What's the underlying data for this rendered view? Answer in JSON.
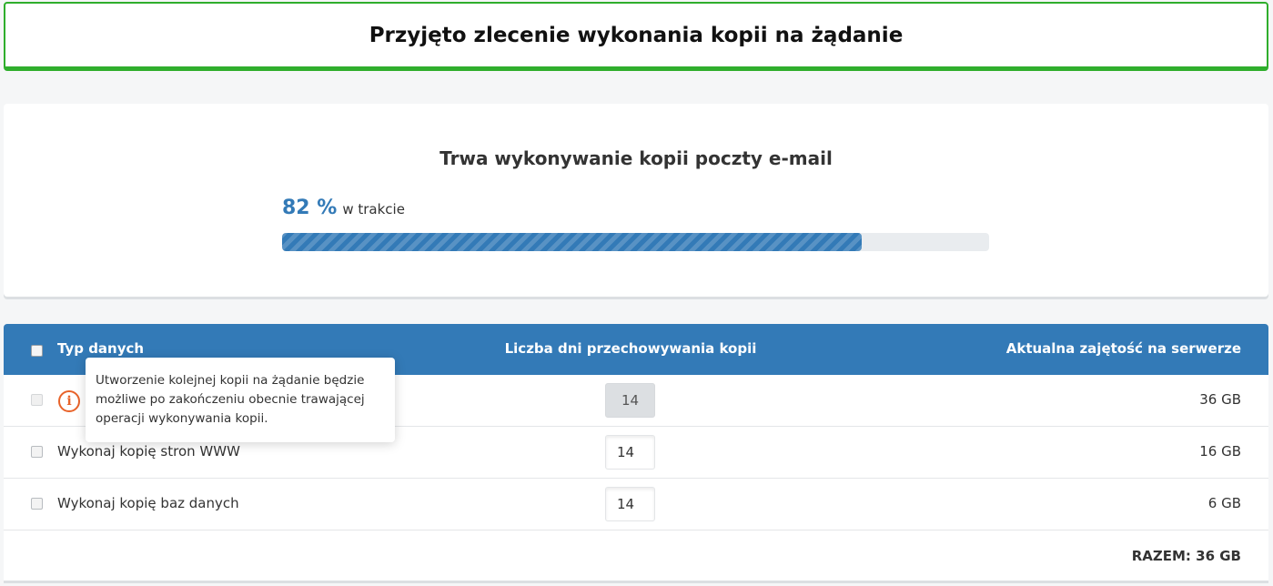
{
  "banner": {
    "title": "Przyjęto zlecenie wykonania kopii na żądanie"
  },
  "progress": {
    "heading": "Trwa wykonywanie kopii poczty e-mail",
    "percent_text": "82 %",
    "status_text": "w trakcie",
    "value": 0.82
  },
  "table": {
    "headers": {
      "type": "Typ danych",
      "days": "Liczba dni przechowywania kopii",
      "usage": "Aktualna zajętość na serwerze"
    },
    "rows": [
      {
        "label": "",
        "days": "14",
        "usage": "36 GB",
        "disabled": true
      },
      {
        "label": "Wykonaj kopię stron WWW",
        "days": "14",
        "usage": "16 GB",
        "disabled": false
      },
      {
        "label": "Wykonaj kopię baz danych",
        "days": "14",
        "usage": "6 GB",
        "disabled": false
      }
    ],
    "total": "RAZEM: 36 GB"
  },
  "tooltip": {
    "text": "Utworzenie kolejnej kopii na żądanie będzie możliwe po zakończeniu obecnie trawającej operacji wykonywania kopii."
  },
  "colors": {
    "accent": "#337ab7",
    "success": "#2fae2c",
    "warning": "#e8632a"
  },
  "icons": {
    "info": "info-circle-icon"
  }
}
